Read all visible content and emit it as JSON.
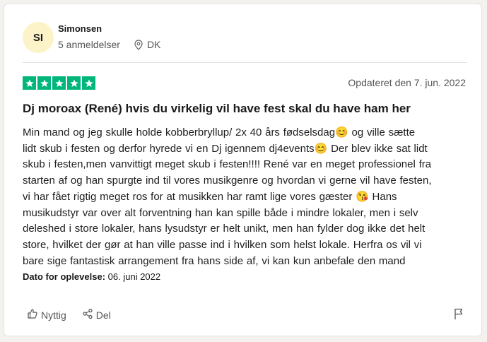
{
  "reviewer": {
    "initials": "SI",
    "name": "Simonsen",
    "review_count": "5 anmeldelser",
    "country": "DK",
    "avatar_color": "#fcf3c8"
  },
  "review": {
    "rating": 5,
    "star_color": "#00b67a",
    "updated": "Opdateret den 7. jun. 2022",
    "title": "Dj moroax (René) hvis du virkelig vil have fest skal du have ham her",
    "body_lines": [
      "Min mand og jeg skulle holde kobberbryllup/ 2x 40 års fødselsdag😊 og ville sætte",
      "lidt skub i festen og derfor hyrede vi en Dj igennem dj4events😊 Der blev ikke sat lidt",
      "skub i festen,men vanvittigt meget skub i festen!!!! René var en meget professionel fra",
      "starten af og han spurgte ind til vores musikgenre og hvordan vi gerne vil have festen,",
      "vi har fået rigtig meget ros for at musikken har ramt lige vores gæster 😘 Hans",
      "musikudstyr var over alt forventning han kan spille både i mindre lokaler, men i selv",
      "deleshed i store lokaler, hans lysudstyr er helt unikt, men han fylder dog ikke det helt",
      "store, hvilket der gør at han ville passe ind i hvilken som helst lokale. Herfra os vil vi",
      "bare sige fantastisk arrangement fra hans side af, vi kan kun anbefale den mand"
    ],
    "experience_label": "Dato for oplevelse:",
    "experience_date": "06. juni 2022"
  },
  "actions": {
    "helpful_label": "Nyttig",
    "share_label": "Del"
  },
  "icons": [
    "location-pin-icon",
    "star-icon",
    "thumbs-up-icon",
    "share-icon",
    "flag-icon"
  ]
}
